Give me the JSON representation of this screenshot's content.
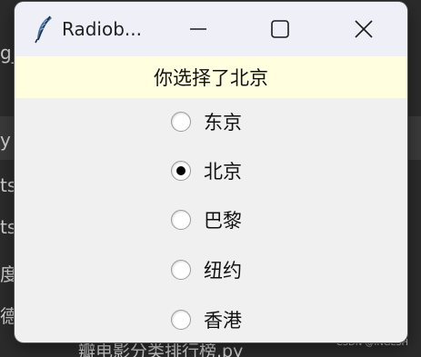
{
  "background": {
    "fragments": [
      "g_",
      "y",
      "ts",
      "ts",
      "度",
      "德",
      "瓣电影分类排行榜.py"
    ],
    "watermark": "CSDN @INGLSH"
  },
  "window": {
    "title": "Radiob...",
    "icon": "feather-icon",
    "status_text": "你选择了北京",
    "selected_index": 1,
    "options": [
      {
        "label": "东京",
        "selected": false
      },
      {
        "label": "北京",
        "selected": true
      },
      {
        "label": "巴黎",
        "selected": false
      },
      {
        "label": "纽约",
        "selected": false
      },
      {
        "label": "香港",
        "selected": false
      }
    ]
  },
  "colors": {
    "status_bg": "#ffffe0",
    "window_bg": "#f0f0f0",
    "titlebar_bg": "#eff0f7",
    "icon_blue": "#4a6fa5"
  }
}
